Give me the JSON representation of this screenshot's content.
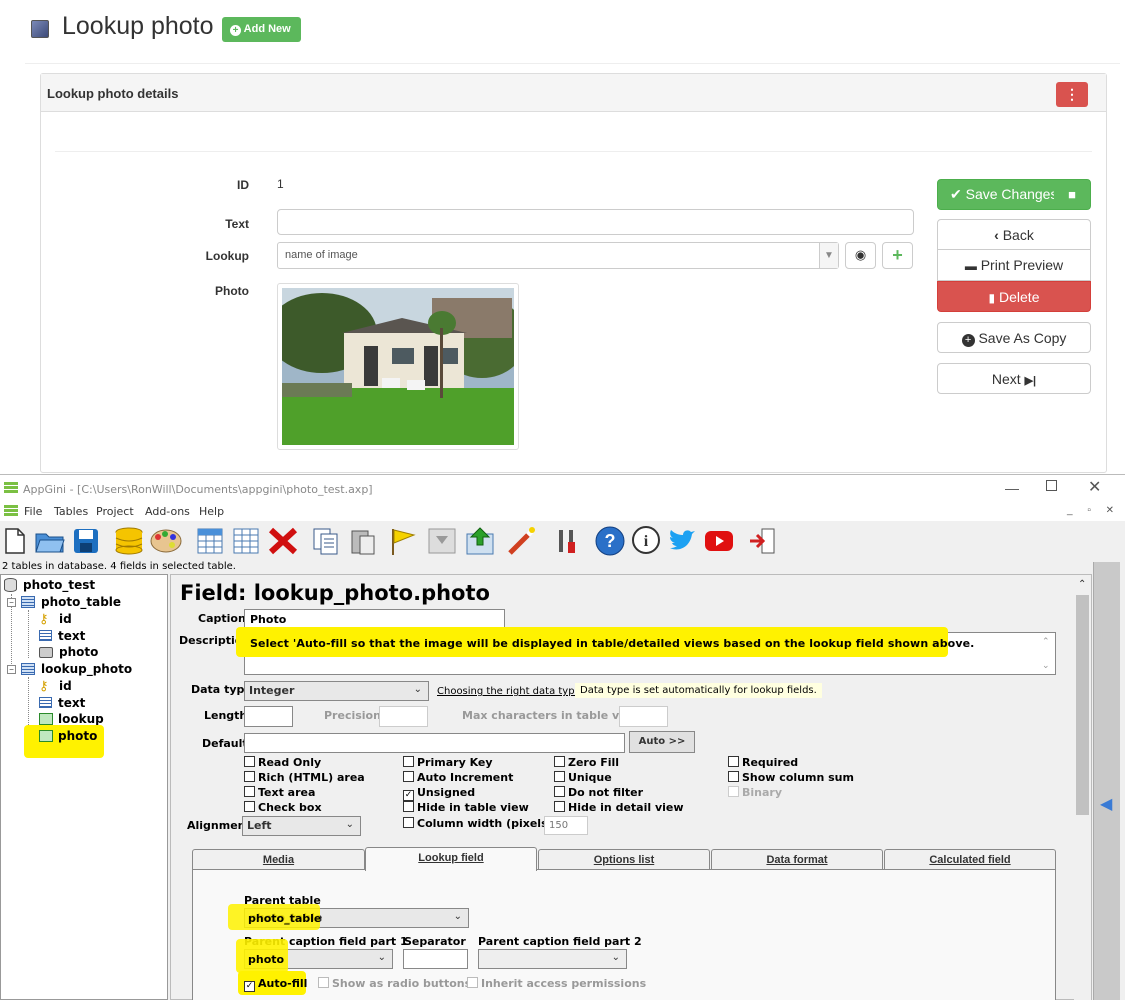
{
  "web": {
    "title": "Lookup photo",
    "add_new": "Add New",
    "panel_title": "Lookup photo details",
    "menu_icon": "vertical-ellipsis-icon",
    "fields": {
      "id_label": "ID",
      "id_value": "1",
      "text_label": "Text",
      "text_value": "",
      "lookup_label": "Lookup",
      "lookup_value": "name of image",
      "photo_label": "Photo"
    },
    "buttons": {
      "save": "Save Changes",
      "back": "Back",
      "print": "Print Preview",
      "delete": "Delete",
      "save_copy": "Save As Copy",
      "next": "Next"
    },
    "colors": {
      "green": "#5cb85c",
      "red": "#d9534f"
    }
  },
  "app": {
    "window_title": "AppGini - [C:\\Users\\RonWill\\Documents\\appgini\\photo_test.axp]",
    "menu": [
      "File",
      "Tables",
      "Project",
      "Add-ons",
      "Help"
    ],
    "status": "2 tables in database. 4 fields in selected table.",
    "tree": {
      "db": "photo_test",
      "t1": "photo_table",
      "t1_fields": [
        "id",
        "text",
        "photo"
      ],
      "t2": "lookup_photo",
      "t2_fields": [
        "id",
        "text",
        "lookup",
        "photo"
      ]
    },
    "field_heading": "Field: lookup_photo.photo",
    "caption_label": "Caption",
    "caption_value": "Photo",
    "description_label": "Description",
    "description_value": "Select 'Auto-fill so that the image will be displayed in table/detailed views based on the lookup field shown above.",
    "datatype_label": "Data type",
    "datatype_value": "Integer",
    "datatype_link": "Choosing the right data type",
    "datatype_note": "Data type is set automatically for lookup fields.",
    "length_label": "Length",
    "precision_label": "Precision",
    "maxchars_label": "Max characters in table view",
    "default_label": "Default",
    "auto_btn": "Auto >>",
    "alignment_label": "Alignment",
    "alignment_value": "Left",
    "colwidth_value": "150",
    "checks": {
      "read_only": "Read Only",
      "rich": "Rich (HTML) area",
      "text_area": "Text area",
      "check_box": "Check box",
      "primary_key": "Primary Key",
      "auto_inc": "Auto Increment",
      "unsigned": "Unsigned",
      "hide_table": "Hide in table view",
      "col_width": "Column width (pixels)",
      "zero_fill": "Zero Fill",
      "unique": "Unique",
      "no_filter": "Do not filter",
      "hide_detail": "Hide in detail view",
      "required": "Required",
      "col_sum": "Show column sum",
      "binary": "Binary"
    },
    "tabs": [
      "Media",
      "Lookup field",
      "Options list",
      "Data format",
      "Calculated field"
    ],
    "lookup": {
      "parent_table_label": "Parent table",
      "parent_table_value": "photo_table",
      "part1_label": "Parent caption field part 1",
      "part1_value": "photo",
      "separator_label": "Separator",
      "part2_label": "Parent caption field part 2",
      "autofill": "Auto-fill",
      "radio": "Show as radio buttons",
      "inherit": "Inherit access permissions"
    },
    "highlight_color": "#fff200"
  }
}
